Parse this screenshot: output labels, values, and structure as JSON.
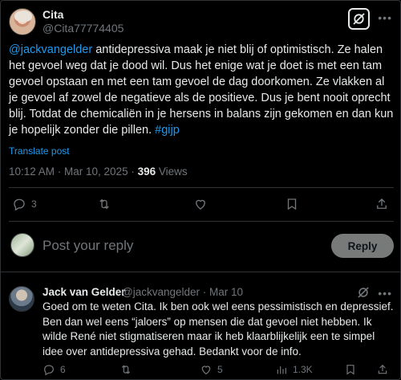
{
  "tweet": {
    "author_name": "Cita",
    "author_handle": "@Cita77774405",
    "text_mention": "@jackvangelder",
    "text_body": " antidepressiva maak je niet blij of optimistisch. Ze halen het gevoel weg dat je dood wil. Dus het enige wat je doet is met een tam gevoel opstaan en met een tam gevoel de dag doorkomen. Ze vlakken al je gevoel af zowel de negatieve als de positieve. Dus je bent nooit oprecht blij. Totdat de chemicaliën in je hersens in balans zijn gekomen en dan kun je hopelijk zonder die pillen. ",
    "text_hashtag": "#gijp",
    "translate_label": "Translate post",
    "timestamp": "10:12 AM · Mar 10, 2025 · ",
    "views_count": "396",
    "views_label": " Views",
    "replies_count": "3",
    "reposts_count": "",
    "likes_count": "",
    "bookmarks_count": ""
  },
  "reply_box": {
    "placeholder": "Post your reply",
    "button_label": "Reply"
  },
  "reply": {
    "author_name": "Jack van Gelder",
    "author_handle": "@jackvangelder",
    "separator": " · ",
    "date": "Mar 10",
    "text": "Goed om te weten Cita. Ik ben ook wel eens pessimistisch en depressief. Ben dan wel eens “jaloers” op mensen die dat gevoel niet hebben. Ik wilde René niet stigmatiseren maar ik heb klaarblijkelijk een te simpel idee over antidepressiva gehad. Bedankt voor de info.",
    "replies_count": "6",
    "reposts_count": "",
    "likes_count": "5",
    "views_count": "1.3K"
  },
  "colors": {
    "accent": "#1d9bf0",
    "muted": "#71767b",
    "text": "#e7e9ea",
    "background": "#000000",
    "border": "#2f3336"
  },
  "icons": [
    "grok-icon",
    "more-icon",
    "reply-icon",
    "repost-icon",
    "like-icon",
    "views-icon",
    "bookmark-icon",
    "share-icon"
  ]
}
